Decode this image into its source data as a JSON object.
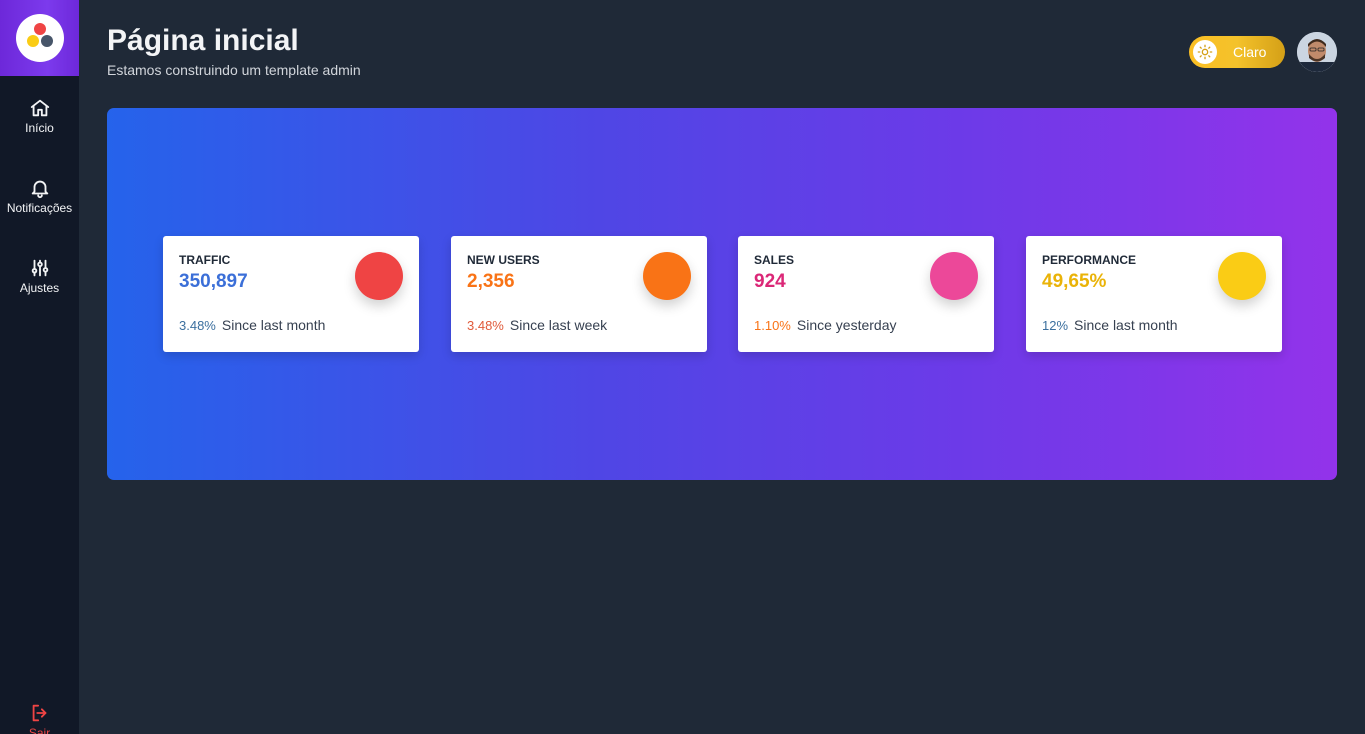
{
  "sidebar": {
    "items": [
      {
        "label": "Início",
        "icon": "home-icon"
      },
      {
        "label": "Notificações",
        "icon": "bell-icon"
      },
      {
        "label": "Ajustes",
        "icon": "sliders-icon"
      }
    ],
    "logout": {
      "label": "Sair",
      "icon": "logout-icon"
    }
  },
  "header": {
    "title": "Página inicial",
    "subtitle": "Estamos construindo um template admin",
    "theme_label": "Claro"
  },
  "colors": {
    "accent_red": "#ef4444",
    "accent_orange": "#f97316",
    "accent_pink": "#ec4899",
    "accent_yellow": "#facc15",
    "primary_blue": "#2563eb",
    "purple": "#9333ea"
  },
  "cards": [
    {
      "title": "TRAFFIC",
      "value": "350,897",
      "pct": "3.48%",
      "period": "Since last month"
    },
    {
      "title": "NEW USERS",
      "value": "2,356",
      "pct": "3.48%",
      "period": "Since last week"
    },
    {
      "title": "SALES",
      "value": "924",
      "pct": "1.10%",
      "period": "Since yesterday"
    },
    {
      "title": "PERFORMANCE",
      "value": "49,65%",
      "pct": "12%",
      "period": "Since last month"
    }
  ]
}
